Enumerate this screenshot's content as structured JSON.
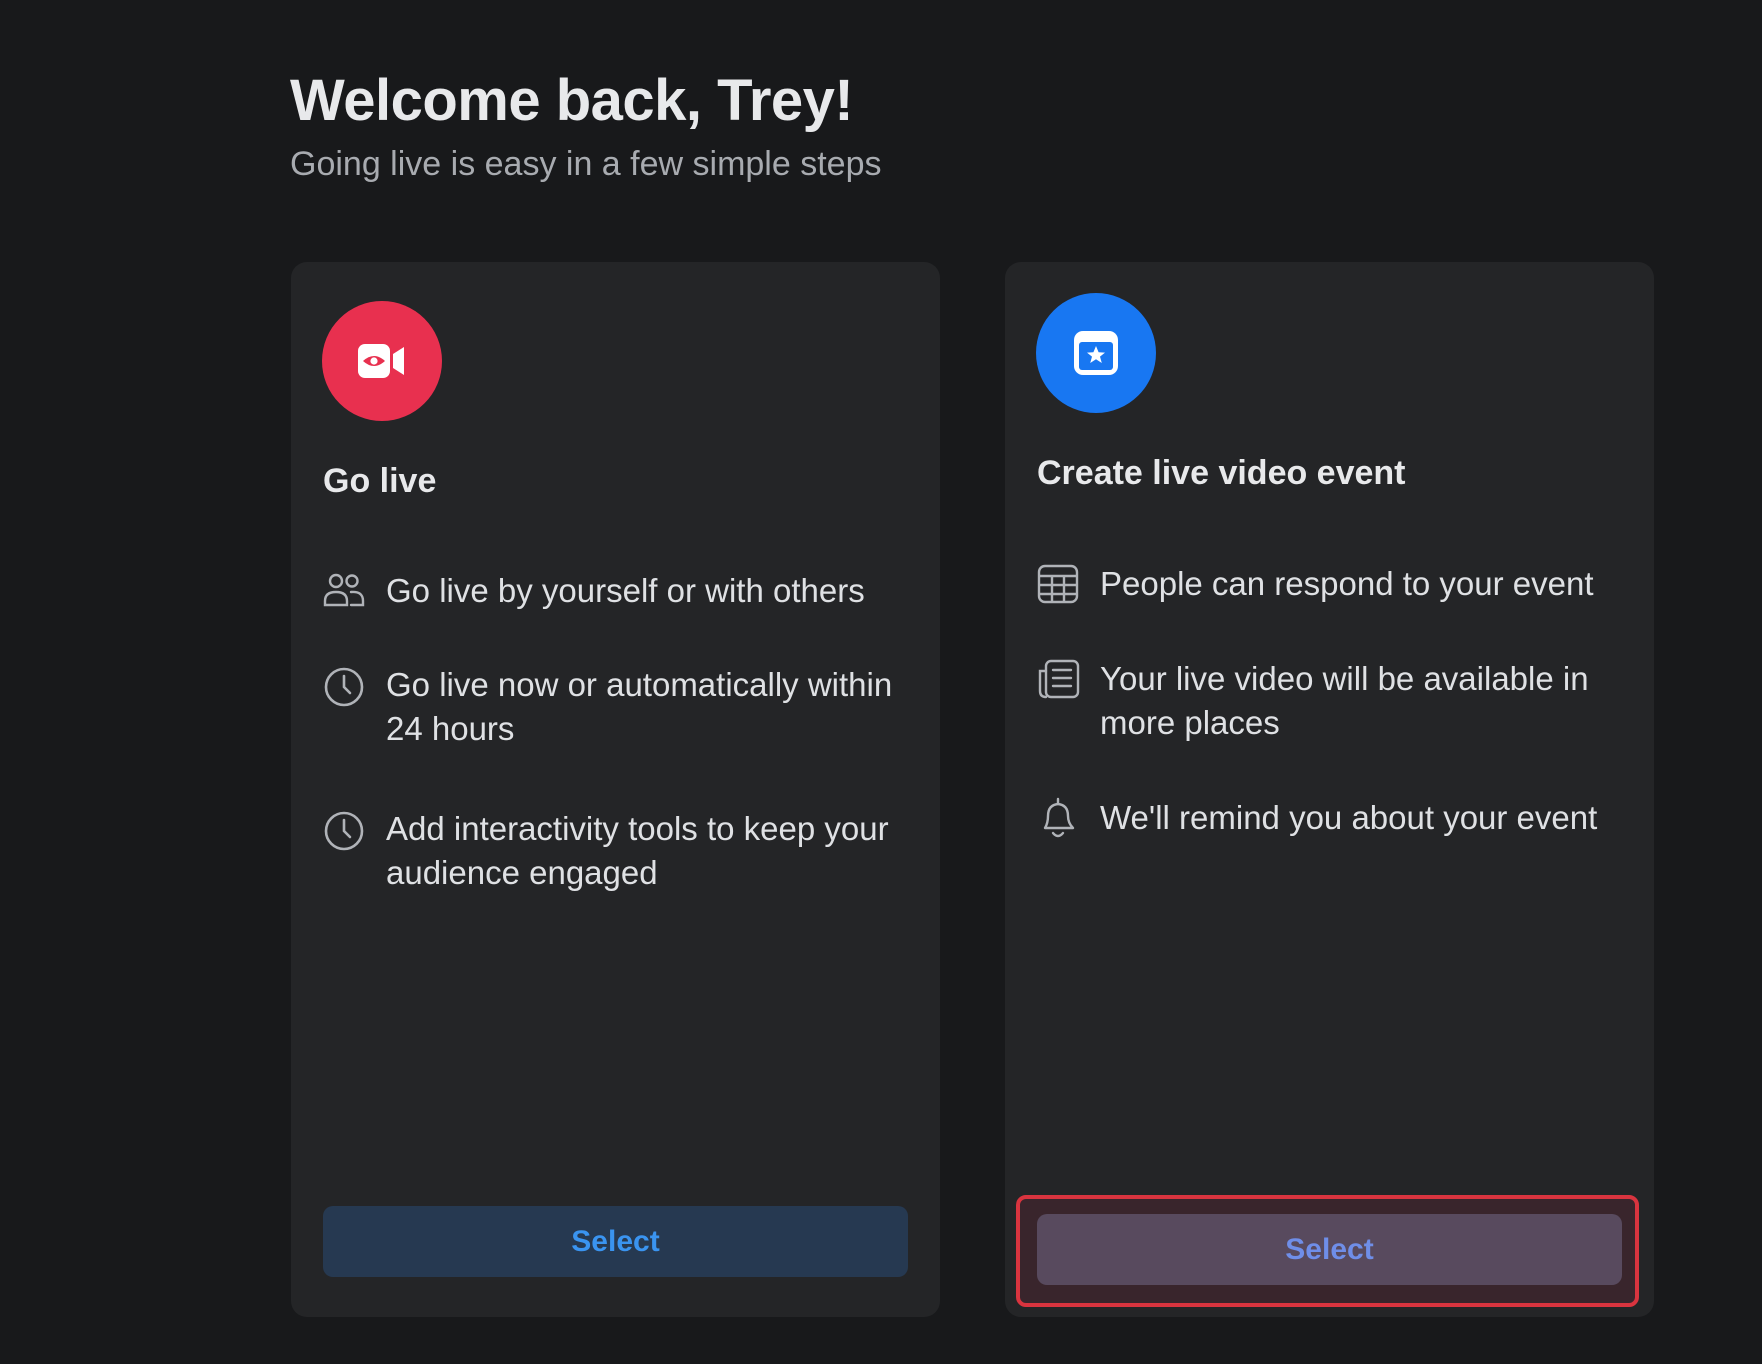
{
  "header": {
    "title": "Welcome back, Trey!",
    "subtitle": "Going live is easy in a few simple steps"
  },
  "cards": [
    {
      "icon": "video-camera-icon",
      "icon_color": "#e8304f",
      "title": "Go live",
      "features": [
        {
          "icon": "people-icon",
          "text": "Go live by yourself or with others"
        },
        {
          "icon": "clock-icon",
          "text": "Go live now or automatically within 24 hours"
        },
        {
          "icon": "clock-icon",
          "text": "Add interactivity tools to keep your audience engaged"
        }
      ],
      "button_label": "Select"
    },
    {
      "icon": "calendar-star-icon",
      "icon_color": "#1877f2",
      "title": "Create live video event",
      "features": [
        {
          "icon": "calendar-grid-icon",
          "text": "People can respond to your event"
        },
        {
          "icon": "newspaper-icon",
          "text": "Your live video will be available in more places"
        },
        {
          "icon": "bell-icon",
          "text": "We'll remind you about your event"
        }
      ],
      "button_label": "Select",
      "highlighted": true,
      "highlight_color": "#d9343f"
    }
  ]
}
